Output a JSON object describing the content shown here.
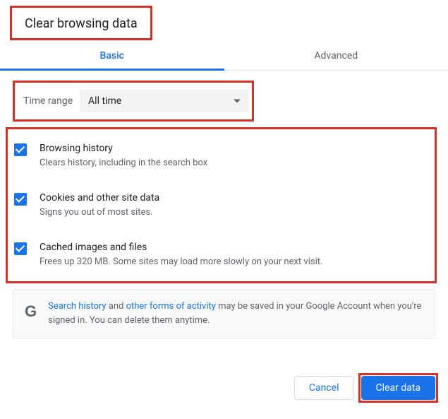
{
  "title": "Clear browsing data",
  "tabs": {
    "basic": "Basic",
    "advanced": "Advanced"
  },
  "timerange": {
    "label": "Time range",
    "selected": "All time"
  },
  "options": [
    {
      "title": "Browsing history",
      "desc": "Clears history, including in the search box",
      "checked": true
    },
    {
      "title": "Cookies and other site data",
      "desc": "Signs you out of most sites.",
      "checked": true
    },
    {
      "title": "Cached images and files",
      "desc": "Frees up 320 MB. Some sites may load more slowly on your next visit.",
      "checked": true
    }
  ],
  "info": {
    "link1": "Search history",
    "mid1": " and ",
    "link2": "other forms of activity",
    "rest": " may be saved in your Google Account when you're signed in. You can delete them anytime."
  },
  "buttons": {
    "cancel": "Cancel",
    "clear": "Clear data"
  }
}
